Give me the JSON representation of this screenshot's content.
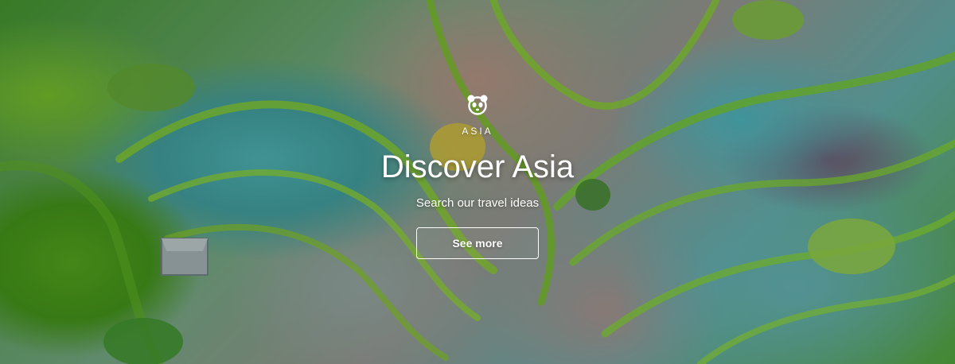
{
  "hero": {
    "logo_icon": "panda-icon",
    "region_label": "ASIA",
    "title": "Discover Asia",
    "subtitle": "Search our travel ideas",
    "cta_label": "See more"
  },
  "colors": {
    "text": "#ffffff",
    "button_border": "#ffffff"
  }
}
